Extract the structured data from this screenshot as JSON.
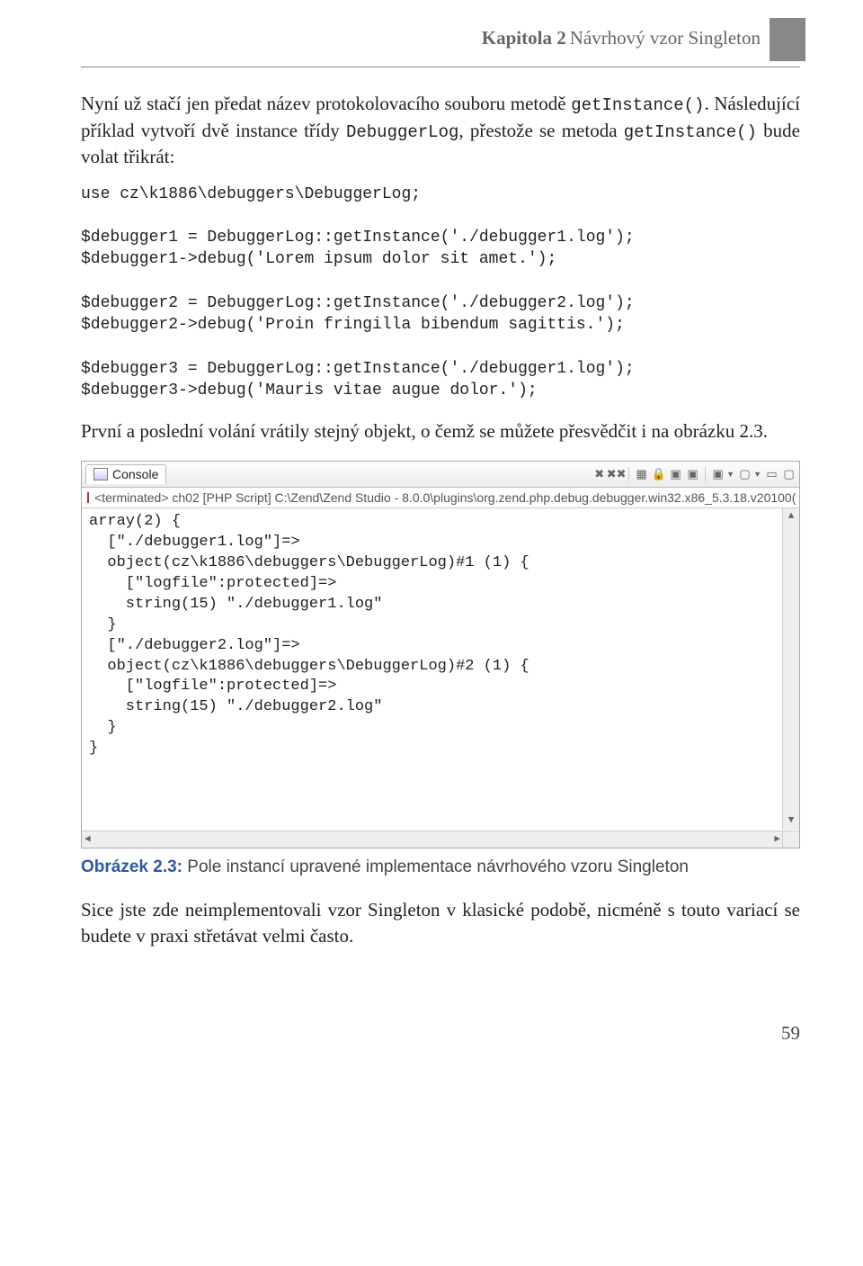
{
  "header": {
    "chapter_label": "Kapitola 2",
    "chapter_title": "Návrhový vzor Singleton"
  },
  "para1_a": "Nyní už stačí jen předat název protokolovacího souboru metodě ",
  "para1_code": "getInstance()",
  "para1_b": ". Následující příklad vytvoří dvě instance třídy ",
  "para1_code2": "DebuggerLog",
  "para1_c": ", přestože se metoda ",
  "para1_code3": "getInstance()",
  "para1_d": " bude volat třikrát:",
  "code1": "use cz\\k1886\\debuggers\\DebuggerLog;\n\n$debugger1 = DebuggerLog::getInstance('./debugger1.log');\n$debugger1->debug('Lorem ipsum dolor sit amet.');\n\n$debugger2 = DebuggerLog::getInstance('./debugger2.log');\n$debugger2->debug('Proin fringilla bibendum sagittis.');\n\n$debugger3 = DebuggerLog::getInstance('./debugger1.log');\n$debugger3->debug('Mauris vitae augue dolor.');",
  "para2": "První a poslední volání vrátily stejný objekt, o čemž se můžete přesvědčit i na obrázku 2.3.",
  "console": {
    "tab_label": "Console",
    "status": "<terminated> ch02 [PHP Script] C:\\Zend\\Zend Studio - 8.0.0\\plugins\\org.zend.php.debug.debugger.win32.x86_5.3.18.v20100(",
    "output": "array(2) {\n  [\"./debugger1.log\"]=>\n  object(cz\\k1886\\debuggers\\DebuggerLog)#1 (1) {\n    [\"logfile\":protected]=>\n    string(15) \"./debugger1.log\"\n  }\n  [\"./debugger2.log\"]=>\n  object(cz\\k1886\\debuggers\\DebuggerLog)#2 (1) {\n    [\"logfile\":protected]=>\n    string(15) \"./debugger2.log\"\n  }\n}"
  },
  "figure_caption_bold": "Obrázek 2.3:",
  "figure_caption_text": " Pole instancí upravené implementace návrhového vzoru Singleton",
  "para3": "Sice jste zde neimplementovali vzor Singleton v klasické podobě, nicméně s touto variací se budete v praxi střetávat velmi často.",
  "page_number": "59"
}
